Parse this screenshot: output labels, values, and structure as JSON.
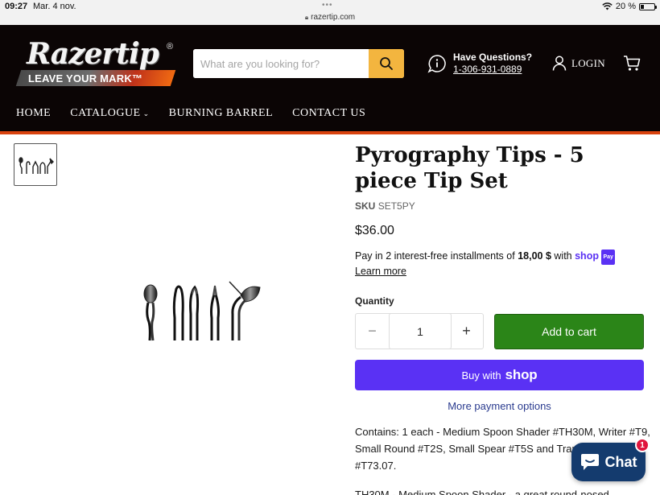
{
  "status_bar": {
    "time": "09:27",
    "date": "Mar. 4 nov.",
    "url": "razertip.com",
    "battery": "20 %",
    "battery_level": 0.2
  },
  "header": {
    "logo_wordmark": "Razertip",
    "logo_tagline": "LEAVE YOUR MARK™",
    "logo_registered": "®",
    "search_placeholder": "What are you looking for?",
    "help_title": "Have Questions?",
    "help_phone": "1-306-931-0889",
    "login_label": "LOGIN"
  },
  "nav": {
    "items": [
      "HOME",
      "CATALOGUE",
      "BURNING BARREL",
      "CONTACT US"
    ]
  },
  "product": {
    "title": "Pyrography Tips - 5 piece Tip Set",
    "sku_label": "SKU",
    "sku_value": "SET5PY",
    "price": "$36.00",
    "installments_prefix": "Pay in 2 interest-free installments of",
    "installments_amount": "18,00 $",
    "installments_with": "with",
    "shop_word": "shop",
    "pay_badge": "Pay",
    "learn_more": "Learn more",
    "quantity_label": "Quantity",
    "quantity_value": "1",
    "minus": "−",
    "plus": "+",
    "add_to_cart": "Add to cart",
    "buy_with": "Buy with",
    "buy_shop": "shop",
    "more_payment": "More payment options",
    "description": "Contains: 1 each - Medium Spoon Shader #TH30M, Writer #T9, Small Round #T2S, Small Spear #T5S and Transfer/Shader #T73.07.",
    "description_next": "TH30M - Medium Spoon Shader - a great round-nosed"
  },
  "chat": {
    "label": "Chat",
    "badge_count": "1"
  },
  "colors": {
    "header_bg": "#0b0505",
    "accent_orange": "#d9430f",
    "search_button": "#f3b53f",
    "add_to_cart": "#2b8518",
    "shop_pay": "#5a31f4",
    "chat_bg": "#143b6e"
  }
}
